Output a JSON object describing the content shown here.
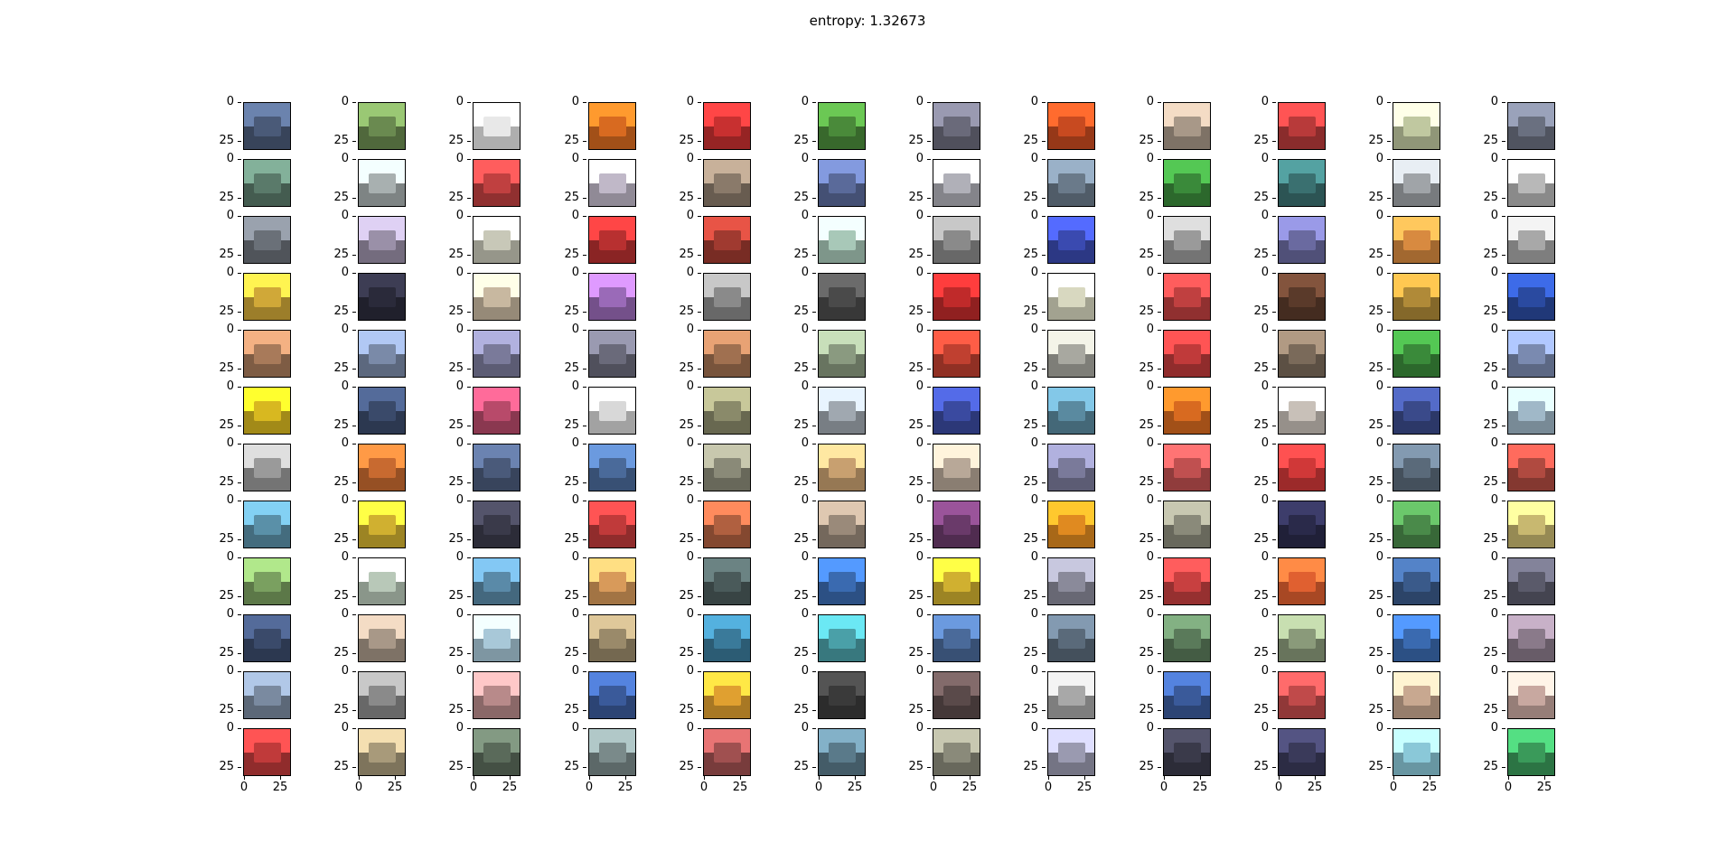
{
  "title": "entropy: 1.32673",
  "grid": {
    "rows": 12,
    "cols": 12
  },
  "y_ticks": [
    "0",
    "25"
  ],
  "x_ticks": [
    "0",
    "25"
  ],
  "thumbnails": [
    [
      "#4a5a78",
      "#6a8a50",
      "#e8e8e8",
      "#d86a20",
      "#c83030",
      "#4a8a3a",
      "#6a6a7a",
      "#c84a20",
      "#a89888",
      "#b83a3a",
      "#c0c8a0",
      "#6a7080"
    ],
    [
      "#5a7a6a",
      "#a8b0b0",
      "#c04040",
      "#c0b8c8",
      "#8a7a6a",
      "#5a6a9a",
      "#b0b0b8",
      "#6a7a8a",
      "#3a8a3a",
      "#3a7070",
      "#a0a4a8",
      "#b8b8b8"
    ],
    [
      "#6a7078",
      "#9a90a8",
      "#c8c8b8",
      "#b83030",
      "#a03a30",
      "#a8c8b8",
      "#8a8a8a",
      "#3a4ab0",
      "#9a9a9a",
      "#6a6aa0",
      "#d88a40",
      "#a8a8a8"
    ],
    [
      "#d0a838",
      "#2a2a3a",
      "#c8b8a0",
      "#9a6ab8",
      "#8a8a8a",
      "#4a4a4a",
      "#c02a2a",
      "#d8d8c0",
      "#c04040",
      "#5a3a2a",
      "#b08a38",
      "#2a4aa0"
    ],
    [
      "#a87a5a",
      "#7a8aa8",
      "#7a7a9a",
      "#6a6a7a",
      "#a07050",
      "#8a9a80",
      "#c04030",
      "#a8a8a0",
      "#c03a3a",
      "#7a6a5a",
      "#3a8a3a",
      "#7a8ab0"
    ],
    [
      "#d8b820",
      "#3a4a6a",
      "#b84a6a",
      "#d8d8d8",
      "#8a8a6a",
      "#a0a8b0",
      "#3a4aa0",
      "#5a8aa0",
      "#d86a20",
      "#c8c0b8",
      "#3a4a8a",
      "#a0b8c8"
    ],
    [
      "#9a9a9a",
      "#c86a30",
      "#4a5a7a",
      "#4a6a9a",
      "#8a8a78",
      "#c8a070",
      "#b8a898",
      "#7a7a9a",
      "#c05050",
      "#d03838",
      "#5a6a7a",
      "#b04a40"
    ],
    [
      "#5a90a8",
      "#d0b030",
      "#3a3a4a",
      "#c03a3a",
      "#b06040",
      "#9a8a7a",
      "#6a3a6a",
      "#e08a20",
      "#8a8a7a",
      "#2a2a4a",
      "#4a8a4a",
      "#c8b870"
    ],
    [
      "#7aa060",
      "#b8c8b8",
      "#5a8aa8",
      "#d89a5a",
      "#4a5a5a",
      "#3a6ab0",
      "#d0b030",
      "#8a8a9a",
      "#c84040",
      "#e06030",
      "#3a5a8a",
      "#5a5a6a"
    ],
    [
      "#3a4a6a",
      "#a89888",
      "#a8c8d8",
      "#9a8a6a",
      "#3a7a9a",
      "#4aa0a8",
      "#4a6a9a",
      "#5a6a7a",
      "#5a7a5a",
      "#8a9a7a",
      "#3a6ab0",
      "#8a7a8a"
    ],
    [
      "#7a8aa0",
      "#8a8a8a",
      "#b88a8a",
      "#3a5a9a",
      "#e0a030",
      "#3a3a3a",
      "#5a4a4a",
      "#a8a8a8",
      "#3a5a9a",
      "#c04a4a",
      "#c8a890",
      "#c8a8a0"
    ],
    [
      "#c03a3a",
      "#a89a7a",
      "#5a6a5a",
      "#7a8a8a",
      "#a05050",
      "#5a7a8a",
      "#8a8a7a",
      "#9a9ab0",
      "#3a3a4a",
      "#3a3a5a",
      "#8ac8d8",
      "#3a9a5a"
    ]
  ]
}
